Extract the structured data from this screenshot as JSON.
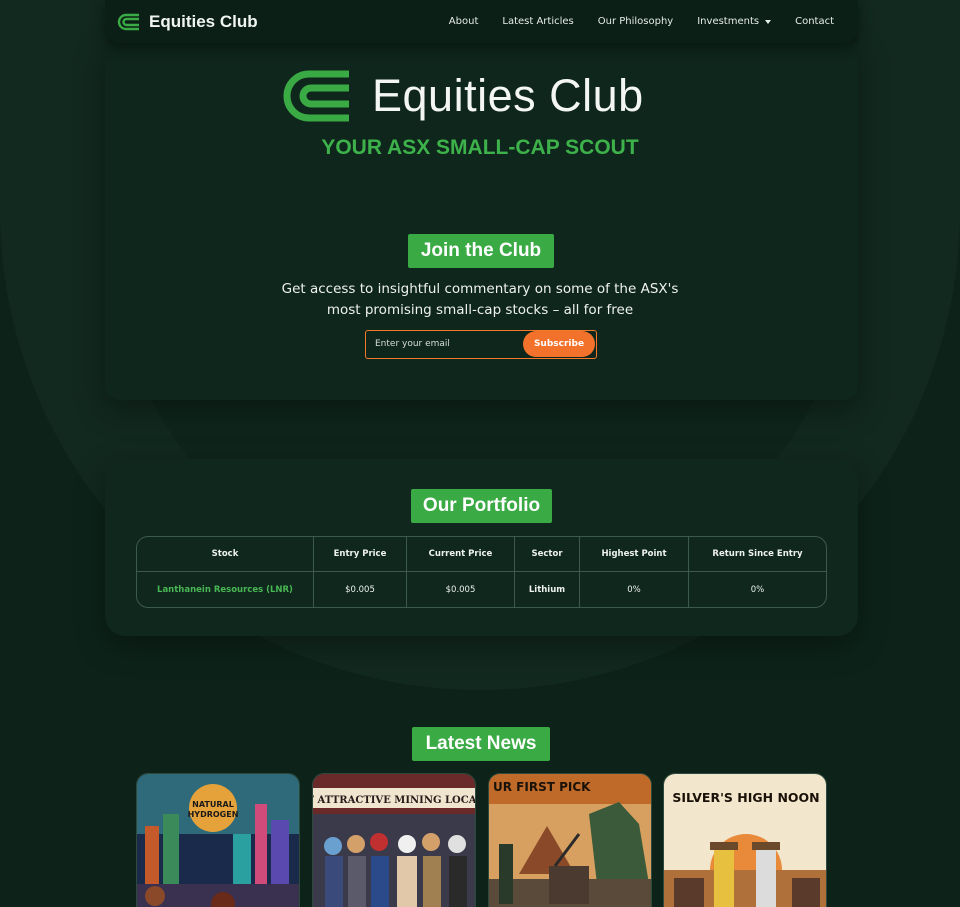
{
  "brand": {
    "name": "Equities Club",
    "logo_icon": "ec-logo-icon",
    "accent": "#3aaa45"
  },
  "nav": {
    "items": [
      "About",
      "Latest Articles",
      "Our Philosophy",
      "Investments",
      "Contact"
    ]
  },
  "hero": {
    "title": "Equities Club",
    "tagline": "YOUR ASX SMALL-CAP SCOUT"
  },
  "join": {
    "heading": "Join the Club",
    "line1": "Get access to insightful commentary on some of the ASX's",
    "line2": "most promising small-cap stocks – all for free",
    "email_placeholder": "Enter your email",
    "subscribe_label": "Subscribe",
    "subscribe_color": "#f3722b"
  },
  "portfolio": {
    "heading": "Our Portfolio",
    "columns": [
      "Stock",
      "Entry Price",
      "Current Price",
      "Sector",
      "Highest Point",
      "Return Since Entry"
    ],
    "rows": [
      [
        "Lanthanein Resources (LNR)",
        "$0.005",
        "$0.005",
        "Lithium",
        "0%",
        "0%"
      ]
    ]
  },
  "news": {
    "heading": "Latest News",
    "cards": [
      {
        "image_text_1": "NATURAL",
        "image_text_2": "HYDROGEN"
      },
      {
        "image_text_1": "T ATTRACTIVE  MINING LOCAT"
      },
      {
        "image_text_1": "UR FIRST PICK"
      },
      {
        "image_text_1": "SILVER'S HIGH NOON"
      }
    ]
  }
}
